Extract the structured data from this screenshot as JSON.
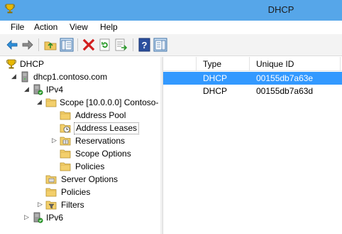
{
  "window": {
    "title": "DHCP",
    "app_icon": "dhcp-trophy-icon"
  },
  "menu": [
    "File",
    "Action",
    "View",
    "Help"
  ],
  "toolbar": {
    "icons": [
      "back-arrow-icon",
      "forward-arrow-icon",
      "up-folder-icon",
      "show-hide-tree-icon",
      "delete-icon",
      "refresh-icon",
      "export-list-icon",
      "help-icon",
      "properties-icon"
    ]
  },
  "tree": {
    "items": [
      {
        "label": "DHCP",
        "icon": "dhcp-trophy-icon",
        "expander": ""
      },
      {
        "label": "dhcp1.contoso.com",
        "icon": "server-icon",
        "expander": "expanded"
      },
      {
        "label": "IPv4",
        "icon": "ipv4-server-icon",
        "expander": "expanded"
      },
      {
        "label": "Scope [10.0.0.0] Contoso-",
        "icon": "folder-icon",
        "expander": "expanded"
      },
      {
        "label": "Address Pool",
        "icon": "folder-icon",
        "expander": ""
      },
      {
        "label": "Address Leases",
        "icon": "folder-clock-icon",
        "expander": "",
        "selected": true
      },
      {
        "label": "Reservations",
        "icon": "folder-grid-icon",
        "expander": "collapsed"
      },
      {
        "label": "Scope Options",
        "icon": "folder-icon",
        "expander": ""
      },
      {
        "label": "Policies",
        "icon": "folder-icon",
        "expander": ""
      },
      {
        "label": "Server Options",
        "icon": "server-options-icon",
        "expander": ""
      },
      {
        "label": "Policies",
        "icon": "folder-icon",
        "expander": ""
      },
      {
        "label": "Filters",
        "icon": "filter-icon",
        "expander": "collapsed"
      },
      {
        "label": "IPv6",
        "icon": "ipv6-server-icon",
        "expander": "collapsed"
      }
    ]
  },
  "list": {
    "columns": [
      "Type",
      "Unique ID"
    ],
    "rows": [
      {
        "type": "DHCP",
        "unique_id": "00155db7a63e",
        "selected": true
      },
      {
        "type": "DHCP",
        "unique_id": "00155db7a63d",
        "selected": false
      }
    ]
  },
  "colors": {
    "titlebar": "#56a6e9",
    "selection": "#3399ff"
  }
}
